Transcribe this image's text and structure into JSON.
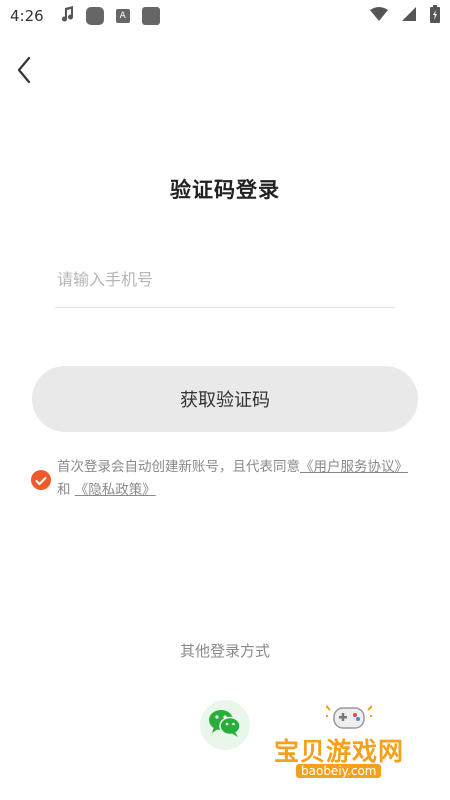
{
  "status_bar": {
    "time": "4:26"
  },
  "header": {
    "back_icon": "chevron-left-icon"
  },
  "page": {
    "title": "验证码登录"
  },
  "phone_input": {
    "placeholder": "请输入手机号",
    "value": ""
  },
  "actions": {
    "get_code_label": "获取验证码"
  },
  "agreement": {
    "checked": true,
    "text": "首次登录会自动创建新账号，且代表同意",
    "user_agreement_link": "《用户服务协议》",
    "conjunction": "和",
    "privacy_link": "《隐私政策》"
  },
  "other_login": {
    "label": "其他登录方式",
    "wechat_icon": "wechat-icon"
  },
  "watermark": {
    "title": "宝贝游戏网",
    "url": "baobeiy.com"
  },
  "colors": {
    "accent": "#ee5a2b",
    "button_bg": "#e9e9e9",
    "wechat": "#2aae3a",
    "watermark": "#f5a01a"
  }
}
